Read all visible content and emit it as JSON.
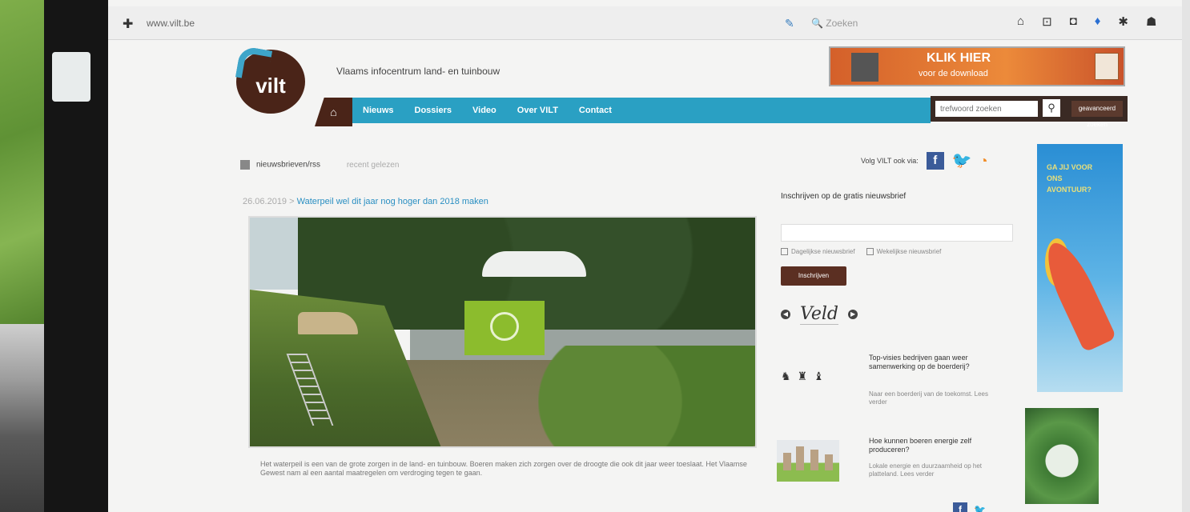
{
  "browser": {
    "url": "www.vilt.be",
    "search_placeholder": "Zoeken",
    "toolbar_icons": [
      "home-icon",
      "download-icon",
      "pocket-icon",
      "extension-icon",
      "star-icon",
      "menu-icon"
    ]
  },
  "site": {
    "logo_text": "vilt",
    "tagline": "Vlaams infocentrum land- en tuinbouw",
    "banner_ad": {
      "headline": "KLIK HIER",
      "subtext": "voor de download"
    },
    "nav": {
      "home_icon": "home-icon",
      "items": [
        "Nieuws",
        "Dossiers",
        "Video",
        "Over VILT",
        "Contact"
      ]
    },
    "search": {
      "placeholder": "trefwoord zoeken",
      "advanced_label": "geavanceerd zoeken"
    },
    "sub_row": {
      "newsletter_link": "nieuwsbrieven/rss",
      "saved_link": "recent gelezen",
      "follow_label": "Volg VILT ook via:"
    },
    "breadcrumb": {
      "date": "26.06.2019",
      "article_title": "Waterpeil wel dit jaar nog hoger dan 2018 maken"
    },
    "article_excerpt": "Het waterpeil is een van de grote zorgen in de land- en tuinbouw. Boeren maken zich zorgen over de droogte die ook dit jaar weer toeslaat. Het Vlaamse Gewest nam al een aantal maatregelen om verdroging tegen te gaan.",
    "newsletter": {
      "title": "Inschrijven op de gratis nieuwsbrief",
      "email_placeholder": "",
      "checkbox_daily": "Dagelijkse nieuwsbrief",
      "checkbox_weekly": "Wekelijkse nieuwsbrief",
      "subscribe_label": "Inschrijven"
    },
    "magazine_logo": "Veld",
    "side_news": [
      {
        "title": "Top-visies bedrijven gaan weer samenwerking op de boerderij?",
        "desc": "Naar een boerderij van de toekomst. Lees verder"
      },
      {
        "title": "Hoe kunnen boeren energie zelf produceren?",
        "desc": "Lokale energie en duurzaamheid op het platteland. Lees verder"
      }
    ],
    "skyscraper_ad_text": "GA JIJ VOOR ONS AVONTUUR?"
  }
}
